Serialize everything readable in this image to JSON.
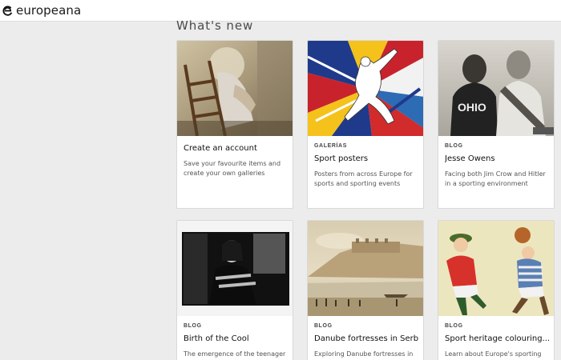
{
  "header": {
    "logo_text": "europeana"
  },
  "section": {
    "title": "What's new"
  },
  "cards": [
    {
      "tag": "",
      "title": "Create an account",
      "desc": "Save your favourite items and create your own galleries",
      "image": "painting-woman-in-chair"
    },
    {
      "tag": "GALERÍAS",
      "title": "Sport posters",
      "desc": "Posters from across Europe for sports and sporting events",
      "image": "poster-athlete-flags"
    },
    {
      "tag": "BLOG",
      "title": "Jesse Owens",
      "desc": "Facing both Jim Crow and Hitler in a sporting environment",
      "image": "photo-athletes"
    },
    {
      "tag": "BLOG",
      "title": "Birth of the Cool",
      "desc": "The emergence of the teenager in",
      "image": "photo-teenager"
    },
    {
      "tag": "BLOG",
      "title": "Danube fortresses in Serbia",
      "desc": "Exploring Danube fortresses in",
      "image": "painting-fortress"
    },
    {
      "tag": "BLOG",
      "title": "Sport heritage colouring...",
      "desc": "Learn about Europe's sporting",
      "image": "illustration-football"
    }
  ],
  "colors": {
    "page_bg": "#ececec",
    "card_bg": "#ffffff",
    "header_bg": "#ffffff"
  }
}
